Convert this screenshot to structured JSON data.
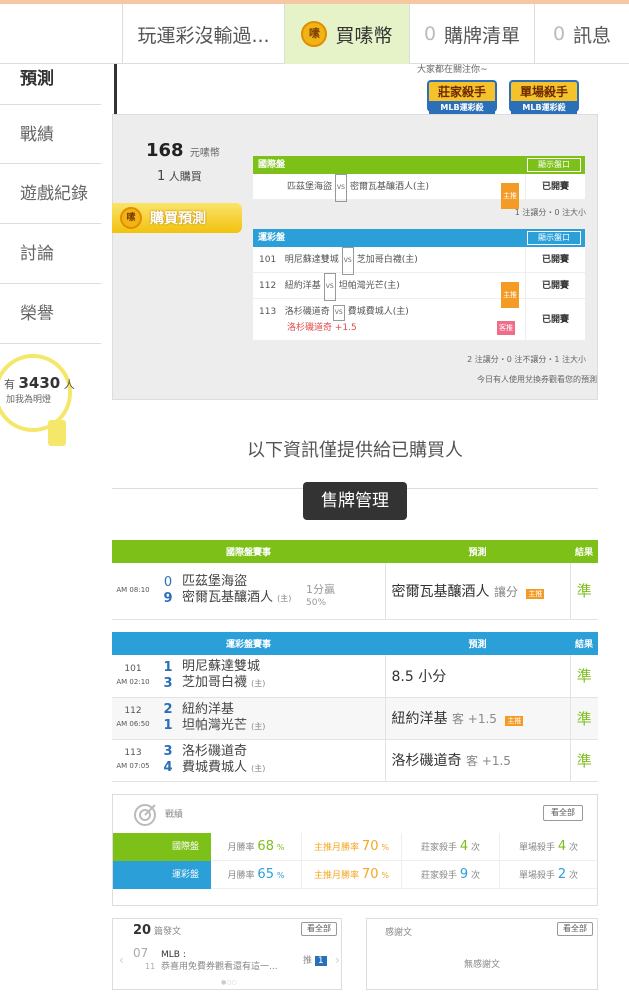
{
  "topbar": {
    "title": "玩運彩沒輸過...",
    "buy_label": "買嗉幣",
    "coin_glyph": "嗉",
    "list_count": "0",
    "list_label": "購牌清單",
    "msg_count": "0",
    "msg_label": "訊息"
  },
  "sidebar": {
    "active": "預測",
    "items": [
      "戰績",
      "遊戲紀錄",
      "討論",
      "榮譽"
    ],
    "bulb_prefix": "有",
    "bulb_count": "3430",
    "bulb_unit": "人",
    "bulb_sub": "加我為明燈"
  },
  "banner": {
    "hint": "大家都在關注你~",
    "badge1": "莊家殺手",
    "badge1_sub": "MLB運彩殺",
    "badge2": "單場殺手",
    "badge2_sub": "MLB運彩殺"
  },
  "preview": {
    "price": "168",
    "price_unit": "元嗉幣",
    "buyers": "1",
    "buyers_unit": "人購買",
    "buy_button": "購買預測",
    "intl": {
      "header": "國際盤",
      "show": "顯示盤口",
      "away": "匹茲堡海盜",
      "vs": "VS",
      "home": "密爾瓦基釀酒人(主)",
      "tag": "主推",
      "result": "已開賽",
      "note": "1 注讓分・0 注大小"
    },
    "lottery": {
      "header": "運彩盤",
      "show": "顯示盤口",
      "rows": [
        {
          "num": "101",
          "away": "明尼蘇達雙城",
          "home": "芝加哥白襪(主)",
          "tag": "",
          "result": "已開賽"
        },
        {
          "num": "112",
          "away": "紐約洋基",
          "home": "坦帕灣光芒(主)",
          "tag": "主推",
          "result": "已開賽"
        },
        {
          "num": "113",
          "away": "洛杉磯道奇",
          "home": "費城費城人(主)",
          "extra": "洛杉磯道奇 +1.5",
          "tag": "客推",
          "result": "已開賽"
        }
      ],
      "note": "2 注讓分・0 注不讓分・1 注大小",
      "note2": "今日有人使用兌換券觀看您的預測"
    }
  },
  "info_text": "以下資訊僅提供給已購買人",
  "mgmt_button": "售牌管理",
  "intl_table": {
    "headers": [
      "國際盤賽事",
      "預測",
      "結果"
    ],
    "rows": [
      {
        "time": "AM 08:10",
        "score_away": "0",
        "score_home": "9",
        "away": "匹茲堡海盜",
        "home": "密爾瓦基釀酒人",
        "home_tag": "(主)",
        "line": "1分贏",
        "line_pct": "50%",
        "pred": "密爾瓦基釀酒人",
        "pred_sub": "讓分",
        "pred_tag": "主推",
        "result": "準"
      }
    ]
  },
  "lottery_table": {
    "headers": [
      "運彩盤賽事",
      "預測",
      "結果"
    ],
    "rows": [
      {
        "num": "101",
        "time": "AM 02:10",
        "score_away": "1",
        "score_home": "3",
        "away": "明尼蘇達雙城",
        "home": "芝加哥白襪",
        "home_tag": "(主)",
        "pred": "8.5 小分",
        "pred_sub": "",
        "pred_tag": "",
        "result": "準"
      },
      {
        "num": "112",
        "time": "AM 06:50",
        "score_away": "2",
        "score_home": "1",
        "away": "紐約洋基",
        "home": "坦帕灣光芒",
        "home_tag": "(主)",
        "pred": "紐約洋基",
        "pred_sub": "客 +1.5",
        "pred_tag": "主推",
        "result": "準"
      },
      {
        "num": "113",
        "time": "AM 07:05",
        "score_away": "3",
        "score_home": "4",
        "away": "洛杉磯道奇",
        "home": "費城費城人",
        "home_tag": "(主)",
        "pred": "洛杉磯道奇",
        "pred_sub": "客 +1.5",
        "pred_tag": "",
        "result": "準"
      }
    ]
  },
  "stats": {
    "title": "戰績",
    "all": "看全部",
    "rows": [
      {
        "label": "國際盤",
        "win_label": "月勝率",
        "win": "68",
        "home_label": "主推月勝率",
        "home": "70",
        "banker_label": "莊家殺手",
        "banker": "4",
        "single_label": "單場殺手",
        "single": "4",
        "unit_pct": "%",
        "unit_times": "次"
      },
      {
        "label": "運彩盤",
        "win_label": "月勝率",
        "win": "65",
        "home_label": "主推月勝率",
        "home": "70",
        "banker_label": "莊家殺手",
        "banker": "9",
        "single_label": "單場殺手",
        "single": "2",
        "unit_pct": "%",
        "unit_times": "次"
      }
    ]
  },
  "posts": {
    "count": "20",
    "label": "篇發文",
    "all": "看全部",
    "date_day": "07",
    "date_month": "11",
    "cat": "MLB :",
    "text": "恭喜用免費券觀看還有這一...",
    "push_label": "推",
    "push_count": "1"
  },
  "thanks": {
    "label": "感謝文",
    "all": "看全部",
    "empty": "無感謝文"
  },
  "colors": {
    "green": "#7cc018",
    "blue": "#2a9fd8",
    "orange": "#f5a623"
  }
}
